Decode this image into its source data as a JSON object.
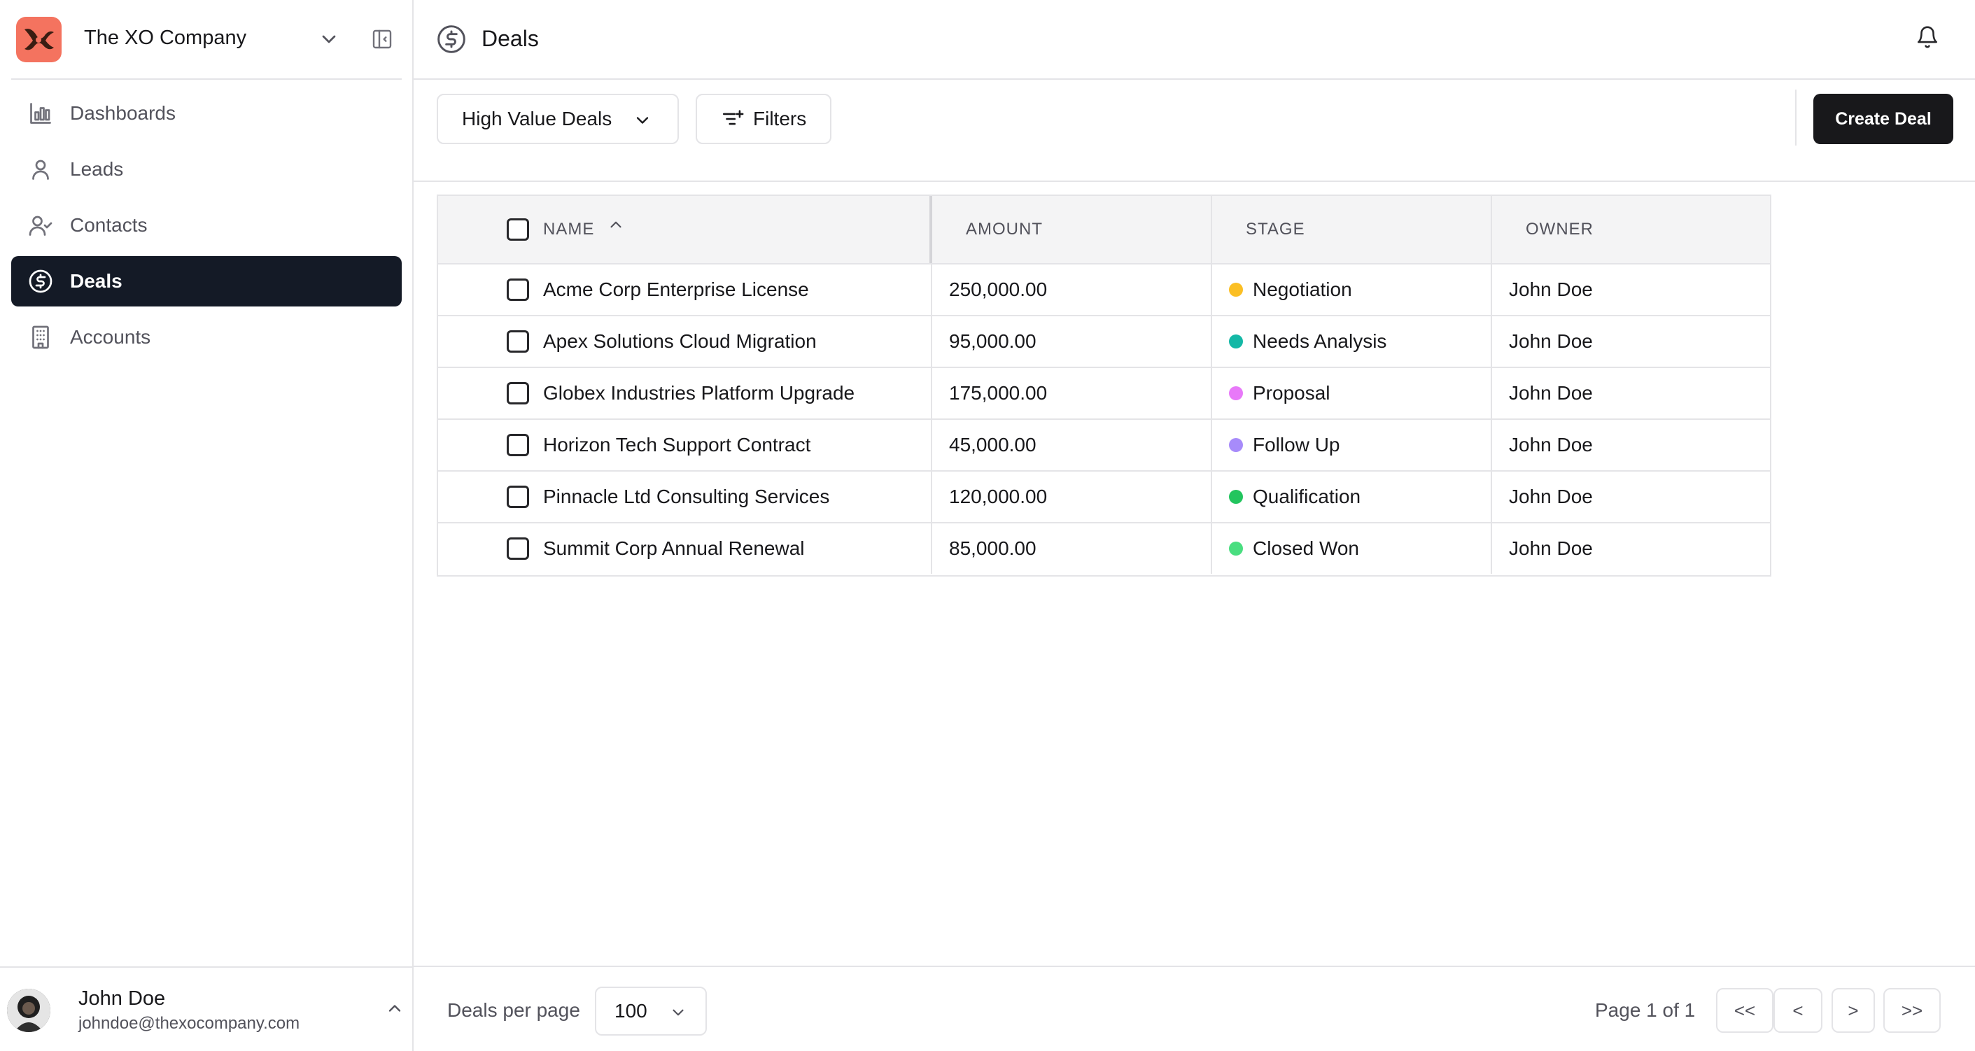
{
  "org": {
    "name": "The XO Company"
  },
  "nav": {
    "items": [
      {
        "label": "Dashboards",
        "icon": "bar-chart-icon"
      },
      {
        "label": "Leads",
        "icon": "user-icon"
      },
      {
        "label": "Contacts",
        "icon": "user-check-icon"
      },
      {
        "label": "Deals",
        "icon": "dollar-circle-icon",
        "active": true
      },
      {
        "label": "Accounts",
        "icon": "building-icon"
      }
    ]
  },
  "user": {
    "name": "John Doe",
    "email": "johndoe@thexocompany.com"
  },
  "header": {
    "title": "Deals"
  },
  "toolbar": {
    "view_label": "High Value Deals",
    "filters_label": "Filters",
    "create_label": "Create Deal"
  },
  "table": {
    "columns": [
      "NAME",
      "AMOUNT",
      "STAGE",
      "OWNER"
    ],
    "rows": [
      {
        "name": "Acme Corp Enterprise License",
        "amount": "250,000.00",
        "stage": "Negotiation",
        "stage_color": "#fbbf24",
        "owner": "John Doe"
      },
      {
        "name": "Apex Solutions Cloud Migration",
        "amount": "95,000.00",
        "stage": "Needs Analysis",
        "stage_color": "#14b8a6",
        "owner": "John Doe"
      },
      {
        "name": "Globex Industries Platform Upgrade",
        "amount": "175,000.00",
        "stage": "Proposal",
        "stage_color": "#e879f9",
        "owner": "John Doe"
      },
      {
        "name": "Horizon Tech Support Contract",
        "amount": "45,000.00",
        "stage": "Follow Up",
        "stage_color": "#a78bfa",
        "owner": "John Doe"
      },
      {
        "name": "Pinnacle Ltd Consulting Services",
        "amount": "120,000.00",
        "stage": "Qualification",
        "stage_color": "#22c55e",
        "owner": "John Doe"
      },
      {
        "name": "Summit Corp Annual Renewal",
        "amount": "85,000.00",
        "stage": "Closed Won",
        "stage_color": "#4ade80",
        "owner": "John Doe"
      }
    ]
  },
  "footer": {
    "per_page_label": "Deals per page",
    "per_page_value": "100",
    "page_info": "Page 1 of 1",
    "first_label": "<<",
    "prev_label": "<",
    "next_label": ">",
    "last_label": ">>"
  }
}
